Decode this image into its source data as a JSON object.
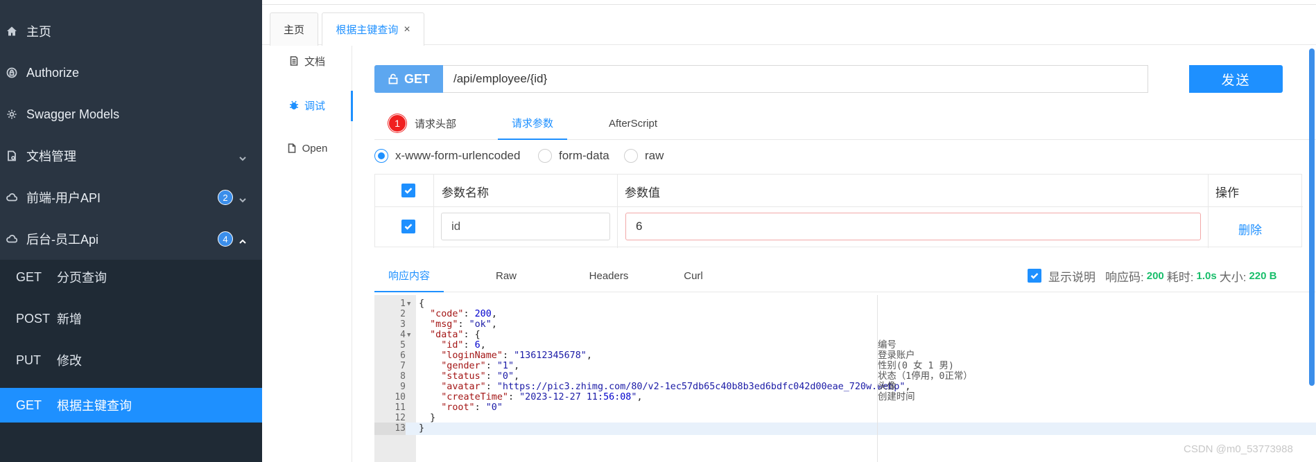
{
  "sidebar": {
    "items": [
      {
        "label": "主页",
        "icon": "home-icon"
      },
      {
        "label": "Authorize",
        "icon": "lock-icon"
      },
      {
        "label": "Swagger Models",
        "icon": "gear-icon"
      },
      {
        "label": "文档管理",
        "icon": "file-gear-icon"
      },
      {
        "label": "前端-用户API",
        "icon": "cloud-icon",
        "badge": "2"
      },
      {
        "label": "后台-员工Api",
        "icon": "cloud-icon",
        "badge": "4"
      }
    ],
    "submenu": [
      {
        "method": "GET",
        "label": "分页查询"
      },
      {
        "method": "POST",
        "label": "新增"
      },
      {
        "method": "PUT",
        "label": "修改"
      },
      {
        "method": "GET",
        "label": "根据主键查询",
        "active": true
      }
    ]
  },
  "page_tabs": [
    {
      "label": "主页"
    },
    {
      "label": "根据主键查询",
      "close": "×"
    }
  ],
  "vertical_tabs": [
    {
      "label": "文档",
      "icon": "document-icon"
    },
    {
      "label": "调试",
      "icon": "bug-icon"
    },
    {
      "label": "Open",
      "icon": "file-icon"
    }
  ],
  "request": {
    "method": "GET",
    "url": "/api/employee/{id}",
    "send_label": "发送"
  },
  "request_tabs": {
    "headers": "请求头部",
    "headers_badge": "1",
    "params": "请求参数",
    "afterscript": "AfterScript"
  },
  "body_types": [
    "x-www-form-urlencoded",
    "form-data",
    "raw"
  ],
  "params_table": {
    "headers": {
      "name": "参数名称",
      "value": "参数值",
      "action": "操作"
    },
    "rows": [
      {
        "name": "id",
        "value": "6",
        "action": "删除"
      }
    ]
  },
  "response_tabs": [
    "响应内容",
    "Raw",
    "Headers",
    "Curl"
  ],
  "response_meta": {
    "show_desc": "显示说明",
    "code_label": "响应码:",
    "code": "200",
    "time_label": "耗时:",
    "time": "1.0s",
    "size_label": "大小:",
    "size": "220 B"
  },
  "code_lines": [
    {
      "n": "1",
      "fold": true,
      "text": "{",
      "comment": ""
    },
    {
      "n": "2",
      "text": "  \"code\": 200,",
      "comment": ""
    },
    {
      "n": "3",
      "text": "  \"msg\": \"ok\",",
      "comment": ""
    },
    {
      "n": "4",
      "fold": true,
      "text": "  \"data\": {",
      "comment": ""
    },
    {
      "n": "5",
      "text": "    \"id\": 6,",
      "comment": "编号"
    },
    {
      "n": "6",
      "text": "    \"loginName\": \"13612345678\",",
      "comment": "登录账户"
    },
    {
      "n": "7",
      "text": "    \"gender\": \"1\",",
      "comment": "性别(0 女 1 男)"
    },
    {
      "n": "8",
      "text": "    \"status\": \"0\",",
      "comment": "状态（1停用，0正常）"
    },
    {
      "n": "9",
      "text": "    \"avatar\": \"https://pic3.zhimg.com/80/v2-1ec57db65c40b8b3ed6bdfc042d00eae_720w.webp\",",
      "comment": "头像"
    },
    {
      "n": "10",
      "text": "    \"createTime\": \"2023-12-27 11:56:08\",",
      "comment": "创建时间"
    },
    {
      "n": "11",
      "text": "    \"root\": \"0\"",
      "comment": ""
    },
    {
      "n": "12",
      "text": "  }",
      "comment": ""
    },
    {
      "n": "13",
      "text": "}",
      "comment": "",
      "highlight": true
    }
  ],
  "watermark": "CSDN @m0_53773988",
  "colors": {
    "accent": "#1e90ff",
    "sidebar": "#2a3542",
    "success": "#19be6b",
    "error_badge": "#f02020"
  }
}
